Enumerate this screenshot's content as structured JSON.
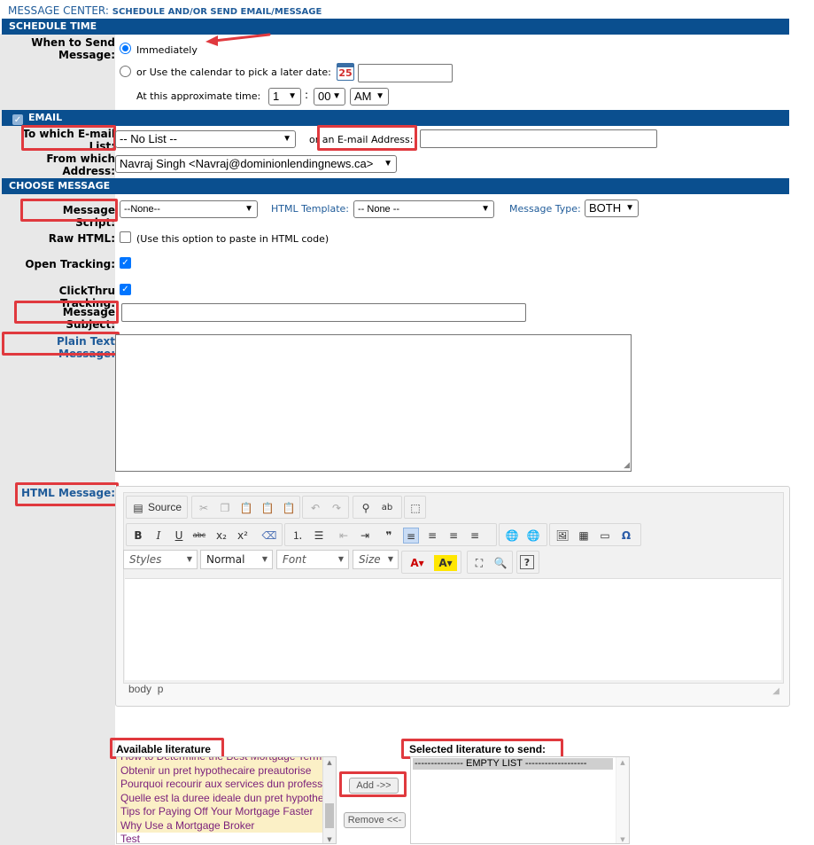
{
  "header": {
    "title_prefix": "MESSAGE CENTER:",
    "title_main": "SCHEDULE AND/OR SEND EMAIL/MESSAGE"
  },
  "sections": {
    "schedule": "SCHEDULE TIME",
    "email": "EMAIL",
    "choose": "CHOOSE MESSAGE"
  },
  "schedule": {
    "when_label": "When to Send Message:",
    "immediately": "Immediately",
    "later": "or Use the calendar to pick a later date:",
    "calendar_day": "25",
    "date_value": "",
    "approx_time_label": "At this approximate time:",
    "hour": "1",
    "minute": "00",
    "ampm": "AM",
    "time_separator": ":"
  },
  "email": {
    "list_label": "To which E-mail List:",
    "list_value": "-- No List --",
    "or_label": "or an E-mail Address:",
    "address_value": "",
    "from_label": "From which Address:",
    "from_value": "Navraj Singh <Navraj@dominionlendingnews.ca>"
  },
  "message": {
    "script_label": "Message Script:",
    "script_value": "--None--",
    "html_template_label": "HTML Template:",
    "html_template_value": "-- None --",
    "type_label": "Message Type:",
    "type_value": "BOTH",
    "raw_html_label": "Raw HTML:",
    "raw_html_hint": "(Use this option to paste in HTML code)",
    "open_tracking_label": "Open Tracking:",
    "clickthru_label": "ClickThru Tracking:",
    "subject_label": "Message Subject:",
    "subject_value": "",
    "plain_text_label": "Plain Text Message:",
    "html_message_label": "HTML Message:"
  },
  "editor": {
    "source_label": "Source",
    "styles": "Styles",
    "format": "Normal",
    "font": "Font",
    "size": "Size",
    "path_body": "body",
    "path_p": "p"
  },
  "literature": {
    "available_label": "Available literature",
    "selected_label": "Selected literature to send:",
    "available_items": [
      "How to Determine the Best Mortgage Term",
      "Obtenir un pret hypothecaire preautorise",
      "Pourquoi recourir aux services dun professionnel",
      "Quelle est la duree ideale dun pret hypothecaire",
      "Tips for Paying Off Your Mortgage Faster",
      "Why Use a Mortgage Broker",
      "Test"
    ],
    "selected_empty": "--------------- EMPTY LIST -------------------",
    "add_button": "Add ->>",
    "remove_button": "Remove <<-"
  },
  "colors": {
    "section_bar": "#0a4f8f",
    "highlight": "#e0393e",
    "accent": "#0075ff"
  }
}
